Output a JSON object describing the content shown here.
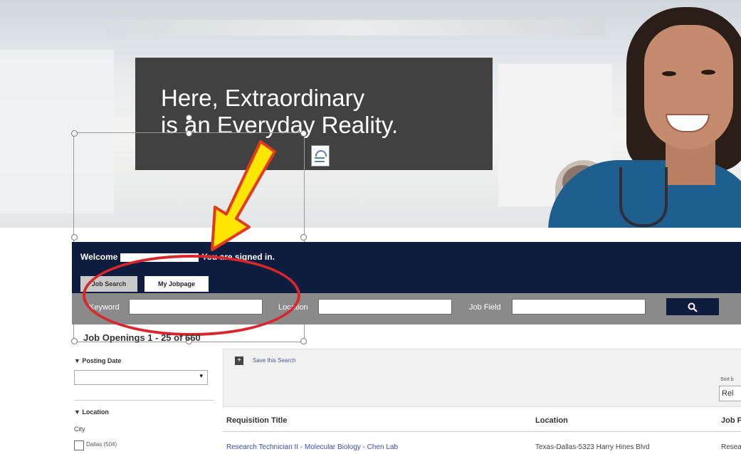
{
  "hero": {
    "headline_line1": "Here, Extraordinary",
    "headline_line2": "is an Everyday Reality."
  },
  "banner": {
    "welcome_prefix": "Welcome",
    "welcome_suffix": "You are signed in.",
    "tabs": [
      {
        "label": "Job Search",
        "active": true
      },
      {
        "label": "My Jobpage",
        "active": false
      }
    ]
  },
  "search": {
    "keyword_label": "Keyword",
    "location_label": "Location",
    "jobfield_label": "Job Field",
    "keyword_value": "",
    "location_value": "",
    "jobfield_value": "",
    "button_icon": "search-icon"
  },
  "results": {
    "heading": "Job Openings 1 - 25 of 660",
    "save_search": "Save this Search",
    "sort_label": "Sort b",
    "sort_value": "Rel",
    "columns": [
      "Requisition Title",
      "Location",
      "Job F"
    ],
    "rows": [
      {
        "title": "Research Technician II - Molecular Biology - Chen Lab",
        "location": "Texas-Dallas-5323 Harry Hines Blvd",
        "job_field": "Resea"
      }
    ]
  },
  "filters": {
    "posting_date_label": "▼ Posting Date",
    "posting_date_value": "",
    "location_label": "▼ Location",
    "city_label": "City",
    "cities": [
      {
        "label": "Dallas (504)",
        "checked": false
      }
    ]
  },
  "colors": {
    "banner": "#0e1d3f",
    "search_bar": "#8a8a8a",
    "headline_box": "#414141",
    "annotation_red": "#d8262b",
    "annotation_yellow": "#ffe600",
    "link_blue": "#3b4fb0"
  }
}
